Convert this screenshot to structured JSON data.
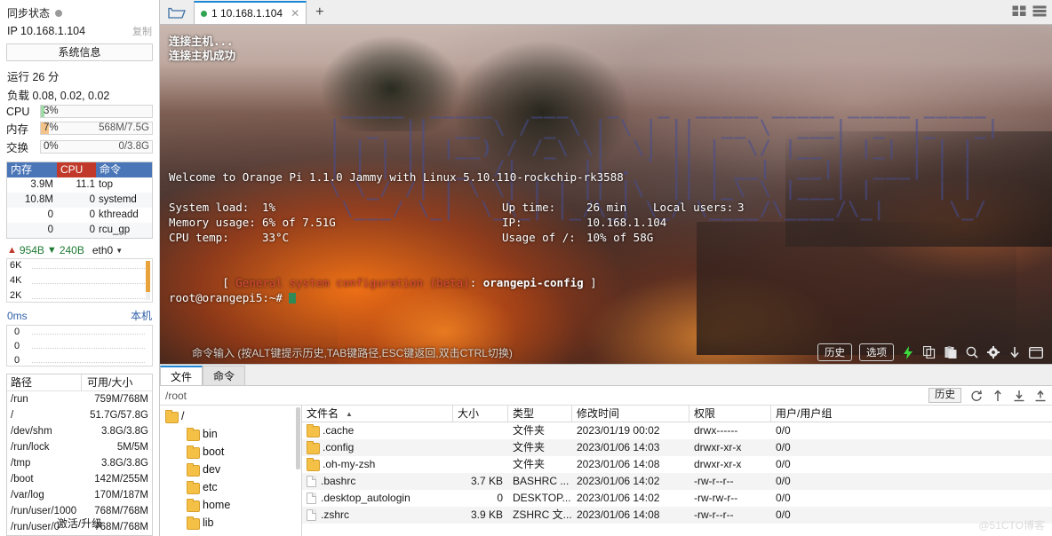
{
  "sidebar": {
    "sync_title": "同步状态",
    "ip_label": "IP 10.168.1.104",
    "copy_label": "复制",
    "sysinfo_button": "系统信息",
    "uptime": "运行 26 分",
    "load": "负载 0.08, 0.02, 0.02",
    "meters": [
      {
        "label": "CPU",
        "percent": "3%",
        "right": "",
        "fill": "#9fdca8",
        "width": "3%"
      },
      {
        "label": "内存",
        "percent": "7%",
        "right": "568M/7.5G",
        "fill": "#f4c38a",
        "width": "7%"
      },
      {
        "label": "交换",
        "percent": "0%",
        "right": "0/3.8G",
        "fill": "#9fdca8",
        "width": "0%"
      }
    ],
    "proc_headers": {
      "mem": "内存",
      "cpu": "CPU",
      "cmd": "命令"
    },
    "proc_rows": [
      {
        "mem": "3.9M",
        "cpu": "11.1",
        "cmd": "top"
      },
      {
        "mem": "10.8M",
        "cpu": "0",
        "cmd": "systemd"
      },
      {
        "mem": "0",
        "cpu": "0",
        "cmd": "kthreadd"
      },
      {
        "mem": "0",
        "cpu": "0",
        "cmd": "rcu_gp"
      }
    ],
    "net": {
      "up_icon": "arrow-up-icon",
      "up_value": "954B",
      "down_icon": "arrow-down-icon",
      "down_value": "240B",
      "interface": "eth0",
      "dropdown_icon": "chevron-down-icon",
      "y_labels": [
        "6K",
        "4K",
        "2K"
      ]
    },
    "latency": {
      "value": "0ms",
      "right_label": "本机",
      "y_labels": [
        "0",
        "0",
        "0"
      ]
    },
    "disk_headers": {
      "path": "路径",
      "size": "可用/大小"
    },
    "disk_rows": [
      {
        "path": "/run",
        "size": "759M/768M"
      },
      {
        "path": "/",
        "size": "51.7G/57.8G"
      },
      {
        "path": "/dev/shm",
        "size": "3.8G/3.8G"
      },
      {
        "path": "/run/lock",
        "size": "5M/5M"
      },
      {
        "path": "/tmp",
        "size": "3.8G/3.8G"
      },
      {
        "path": "/boot",
        "size": "142M/255M"
      },
      {
        "path": "/var/log",
        "size": "170M/187M"
      },
      {
        "path": "/run/user/1000",
        "size": "768M/768M"
      },
      {
        "path": "/run/user/0",
        "size": "768M/768M"
      }
    ],
    "activate_label": "激活/升级"
  },
  "tabbar": {
    "folder_icon": "folder-open-icon",
    "tab_label": "1  10.168.1.104",
    "tab_close_icon": "close-icon",
    "new_tab_icon": "plus-icon",
    "grid_view_icon": "grid-view-icon",
    "list_view_icon": "list-view-icon"
  },
  "terminal": {
    "connect_line1": "连接主机...",
    "connect_line2": "连接主机成功",
    "ascii_art": " _____  _____   ___   _   _  _____ _____ _____ _____ \n|  _  ||  __ \\ / _ \\ | \\ | ||  __ \\  ___|  _  |_   _|\n| | | || |__) / /_\\ \\|  \\| || |  \\/ |__ | |_| | | |  \n| | | ||  _  /|  _  || . ` || | __|  __||  ___| | |  \n\\ \\_/ /| | \\ \\| | | || |\\  || |_\\ \\ |___| |     | |  \n \\___/ \\_|  \\_\\_| |_/\\_| \\_/ \\____/\\____/\\_|     \\_/  ",
    "welcome": "Welcome to Orange Pi 1.1.0 Jammy with Linux 5.10.110-rockchip-rk3588",
    "stats": [
      {
        "label": "System load:",
        "value": "1%",
        "label2": "Up time:",
        "value2": "26 min",
        "label3": "Local users:",
        "value3": "3"
      },
      {
        "label": "Memory usage:",
        "value": "6% of 7.51G",
        "label2": "IP:",
        "value2": "10.168.1.104",
        "label3": "",
        "value3": ""
      },
      {
        "label": "CPU temp:",
        "value": "33°C",
        "label2": "Usage of /:",
        "value2": "10% of 58G",
        "label3": "",
        "value3": ""
      }
    ],
    "config_line_prefix": "[ ",
    "config_line_red": "General system configuration (beta)",
    "config_line_sep": ": ",
    "config_line_cmd": "orangepi-config",
    "config_line_suffix": " ]",
    "prompt": "root@orangepi5:~# ",
    "bottom_hint": "命令输入 (按ALT键提示历史,TAB键路径,ESC键返回,双击CTRL切换)",
    "bottom_buttons": [
      {
        "label": "历史",
        "name": "history-button"
      },
      {
        "label": "选项",
        "name": "options-button"
      }
    ],
    "bottom_icons": [
      "lightning-icon",
      "copy-icon",
      "paste-icon",
      "search-icon",
      "gear-icon",
      "download-icon",
      "window-icon"
    ]
  },
  "filemanager": {
    "tabs": [
      {
        "label": "文件",
        "active": true
      },
      {
        "label": "命令",
        "active": false
      }
    ],
    "path": "/root",
    "history_button": "历史",
    "toolbar_icons": [
      "refresh-icon",
      "upload-arrow-icon",
      "download-icon",
      "upload-icon"
    ],
    "tree": [
      {
        "label": "/",
        "depth": 0,
        "type": "root"
      },
      {
        "label": "bin",
        "depth": 1,
        "type": "link"
      },
      {
        "label": "boot",
        "depth": 1,
        "type": "folder"
      },
      {
        "label": "dev",
        "depth": 1,
        "type": "folder"
      },
      {
        "label": "etc",
        "depth": 1,
        "type": "folder"
      },
      {
        "label": "home",
        "depth": 1,
        "type": "folder"
      },
      {
        "label": "lib",
        "depth": 1,
        "type": "link"
      }
    ],
    "columns": [
      {
        "label": "文件名",
        "key": "name",
        "sorted": true
      },
      {
        "label": "大小",
        "key": "size"
      },
      {
        "label": "类型",
        "key": "type"
      },
      {
        "label": "修改时间",
        "key": "mtime"
      },
      {
        "label": "权限",
        "key": "perm"
      },
      {
        "label": "用户/用户组",
        "key": "owner"
      }
    ],
    "rows": [
      {
        "icon": "folder",
        "name": ".cache",
        "size": "",
        "type": "文件夹",
        "mtime": "2023/01/19 00:02",
        "perm": "drwx------",
        "owner": "0/0"
      },
      {
        "icon": "folder",
        "name": ".config",
        "size": "",
        "type": "文件夹",
        "mtime": "2023/01/06 14:03",
        "perm": "drwxr-xr-x",
        "owner": "0/0"
      },
      {
        "icon": "folder",
        "name": ".oh-my-zsh",
        "size": "",
        "type": "文件夹",
        "mtime": "2023/01/06 14:08",
        "perm": "drwxr-xr-x",
        "owner": "0/0"
      },
      {
        "icon": "file",
        "name": ".bashrc",
        "size": "3.7 KB",
        "type": "BASHRC ...",
        "mtime": "2023/01/06 14:02",
        "perm": "-rw-r--r--",
        "owner": "0/0"
      },
      {
        "icon": "file",
        "name": ".desktop_autologin",
        "size": "0",
        "type": "DESKTOP...",
        "mtime": "2023/01/06 14:02",
        "perm": "-rw-rw-r--",
        "owner": "0/0"
      },
      {
        "icon": "file",
        "name": ".zshrc",
        "size": "3.9 KB",
        "type": "ZSHRC 文...",
        "mtime": "2023/01/06 14:08",
        "perm": "-rw-r--r--",
        "owner": "0/0"
      }
    ]
  },
  "watermark": "@51CTO博客"
}
